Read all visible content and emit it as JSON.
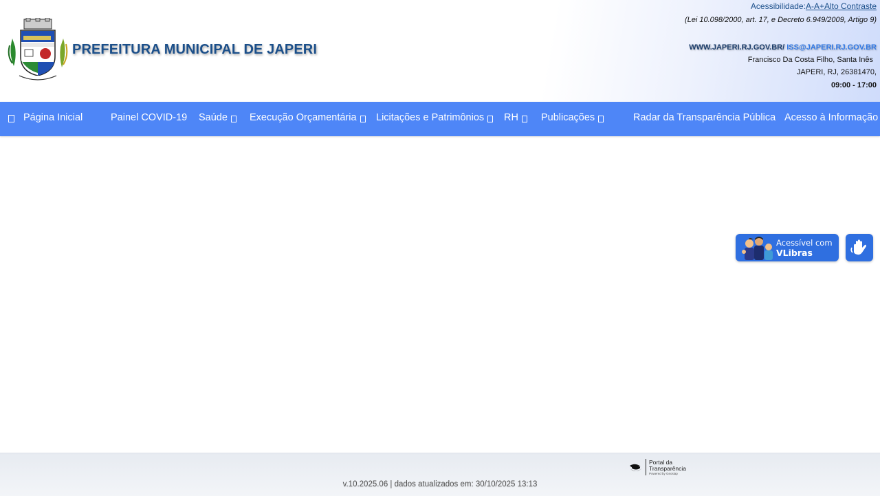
{
  "header": {
    "title": "PREFEITURA MUNICIPAL DE JAPERI",
    "accessibility": {
      "label": "Acessibilidade:",
      "font_decrease": "A-",
      "font_increase": "A+",
      "high_contrast": "Alto Contraste"
    },
    "law_note": "(Lei 10.098/2000, art. 17, e Decreto 6.949/2009, Artigo 9)",
    "website": "WWW.JAPERI.RJ.GOV.BR/",
    "email": "ISS@JAPERI.RJ.GOV.BR",
    "address_line1": "Francisco Da Costa Filho, Santa Inês",
    "address_line2": "JAPERI, RJ, 26381470,",
    "hours": "09:00 - 17:00"
  },
  "nav": {
    "items": [
      {
        "label": "Página Inicial",
        "has_dropdown": false
      },
      {
        "label": "Painel COVID-19",
        "has_dropdown": false
      },
      {
        "label": "Saúde",
        "has_dropdown": true
      },
      {
        "label": "Execução Orçamentária",
        "has_dropdown": true
      },
      {
        "label": "Licitações e Patrimônios",
        "has_dropdown": true
      },
      {
        "label": "RH",
        "has_dropdown": true
      },
      {
        "label": "Publicações",
        "has_dropdown": true
      },
      {
        "label": "Radar da Transparência Pública",
        "has_dropdown": false
      },
      {
        "label": "Acesso à Informação",
        "has_dropdown": true
      }
    ],
    "color": "#4e86f7"
  },
  "vlibras": {
    "badge_line1": "Acessível com",
    "badge_line2": "VLibras",
    "button_icon": "hands-sign-language-icon",
    "color": "#2f6fe0"
  },
  "footer": {
    "brand_line1": "Portal da",
    "brand_line2": "Transparência",
    "brand_line3": "Powered by Geosiap",
    "version": "v.10.2025.06 | dados atualizados em: 30/10/2025 13:13"
  },
  "colors": {
    "title": "#1b4f8a",
    "email": "#2f78e6"
  }
}
